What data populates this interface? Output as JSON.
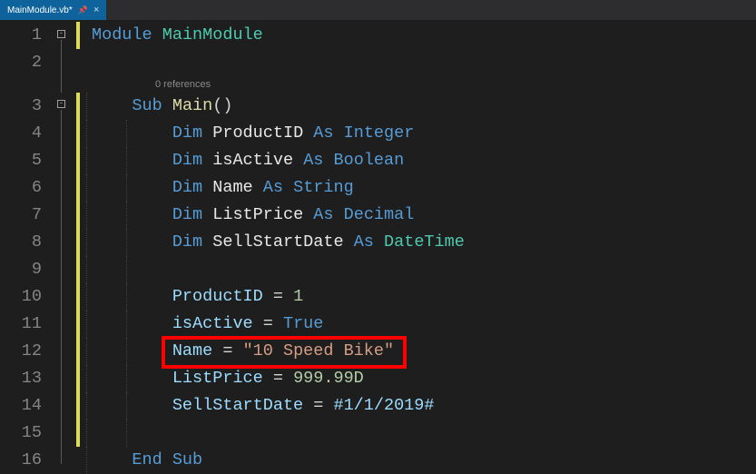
{
  "tab": {
    "title": "MainModule.vb*",
    "close_glyph": "×"
  },
  "ref_label": "0 references",
  "gutter": [
    "1",
    "2",
    "3",
    "4",
    "5",
    "6",
    "7",
    "8",
    "9",
    "10",
    "11",
    "12",
    "13",
    "14",
    "15",
    "16"
  ],
  "code": {
    "l1_kw": "Module",
    "l1_id": "MainModule",
    "l3_kw": "Sub",
    "l3_id": "Main",
    "l3_paren": "()",
    "l4_dim": "Dim",
    "l4_var": "ProductID",
    "l4_as": "As",
    "l4_ty": "Integer",
    "l5_dim": "Dim",
    "l5_var": "isActive",
    "l5_as": "As",
    "l5_ty": "Boolean",
    "l6_dim": "Dim",
    "l6_var": "Name",
    "l6_as": "As",
    "l6_ty": "String",
    "l7_dim": "Dim",
    "l7_var": "ListPrice",
    "l7_as": "As",
    "l7_ty": "Decimal",
    "l8_dim": "Dim",
    "l8_var": "SellStartDate",
    "l8_as": "As",
    "l8_ty": "DateTime",
    "l10_var": "ProductID",
    "l10_eq": " = ",
    "l10_val": "1",
    "l11_var": "isActive",
    "l11_eq": " = ",
    "l11_val": "True",
    "l12_var": "Name",
    "l12_eq": " = ",
    "l12_val": "\"10 Speed Bike\"",
    "l13_var": "ListPrice",
    "l13_eq": " = ",
    "l13_val": "999.99D",
    "l14_var": "SellStartDate",
    "l14_eq": " = ",
    "l14_val": "#1/1/2019#",
    "l16": "End Sub"
  }
}
